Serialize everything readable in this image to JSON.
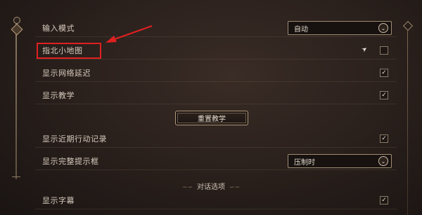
{
  "settings": {
    "rows": [
      {
        "label": "输入模式",
        "type": "dropdown",
        "value": "自动"
      },
      {
        "label": "指北小地图",
        "type": "checkbox",
        "checked": false
      },
      {
        "label": "显示网络延迟",
        "type": "checkbox",
        "checked": true
      },
      {
        "label": "显示教学",
        "type": "checkbox",
        "checked": true
      },
      {
        "label": "显示近期行动记录",
        "type": "checkbox",
        "checked": true
      },
      {
        "label": "显示完整提示框",
        "type": "dropdown",
        "value": "压制时"
      },
      {
        "label": "显示字幕",
        "type": "checkbox",
        "checked": true
      }
    ],
    "reset_tutorial_button": "重置教学",
    "section_dialogue": "对话选项"
  },
  "check_glyph": "✓",
  "chevron_glyph": "⌄",
  "colors": {
    "highlight": "#e02020",
    "background": "#2b211d",
    "text": "#d8ccbe"
  }
}
